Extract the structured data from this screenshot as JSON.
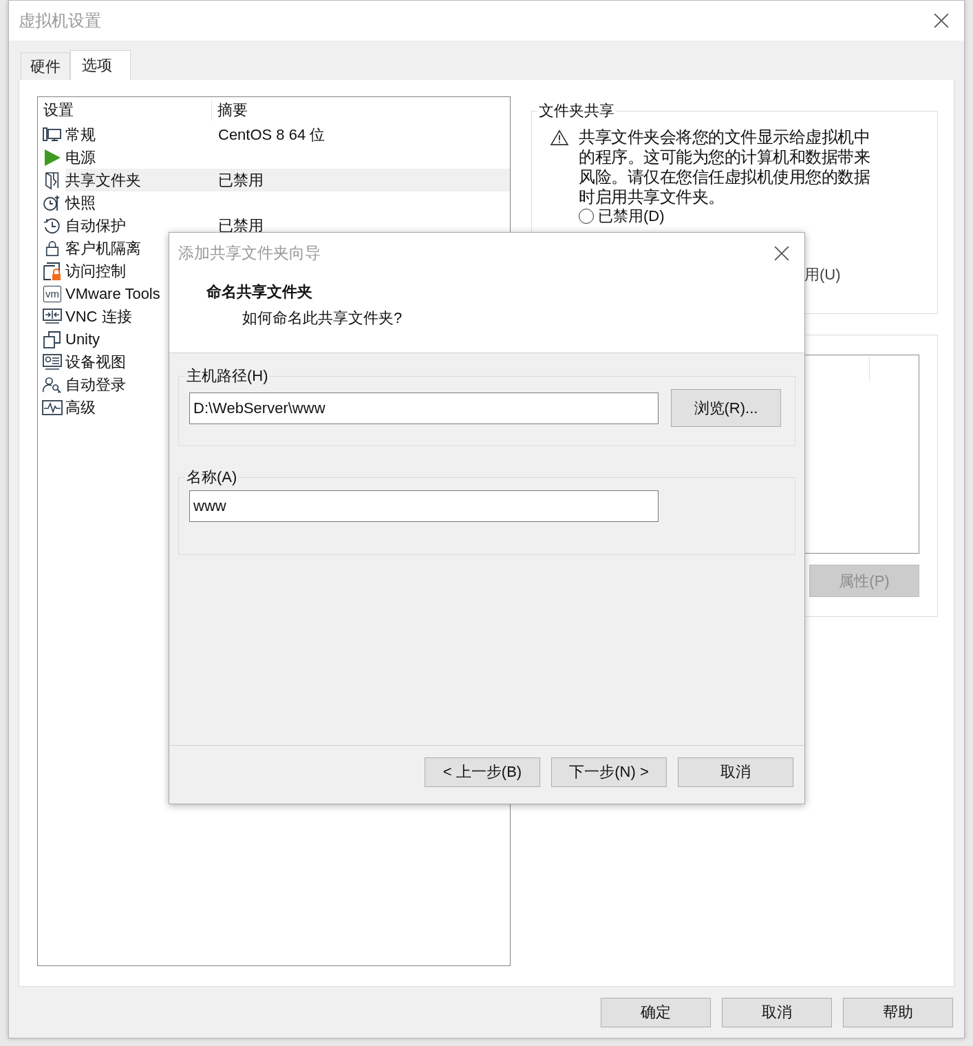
{
  "window": {
    "title": "虚拟机设置"
  },
  "tabs": [
    {
      "label": "硬件",
      "selected": false
    },
    {
      "label": "选项",
      "selected": true
    }
  ],
  "settings_list": {
    "columns": [
      "设置",
      "摘要"
    ],
    "rows": [
      {
        "name": "常规",
        "summary": "CentOS 8 64 位",
        "selected": false
      },
      {
        "name": "电源",
        "selected": false
      },
      {
        "name": "共享文件夹",
        "summary": "已禁用",
        "selected": true
      },
      {
        "name": "快照",
        "selected": false
      },
      {
        "name": "自动保护",
        "summary": "已禁用",
        "selected": false
      },
      {
        "name": "客户机隔离",
        "selected": false
      },
      {
        "name": "访问控制",
        "selected": false
      },
      {
        "name": "VMware Tools",
        "logo": "vm",
        "selected": false
      },
      {
        "name": "VNC 连接",
        "selected": false
      },
      {
        "name": "Unity",
        "selected": false
      },
      {
        "name": "设备视图",
        "selected": false
      },
      {
        "name": "自动登录",
        "selected": false
      },
      {
        "name": "高级",
        "selected": false
      }
    ]
  },
  "folder_sharing": {
    "title": "文件夹共享",
    "warning": "共享文件夹会将您的文件显示给虚拟机中的程序。这可能为您的计算机和数据带来风险。请仅在您信任虚拟机使用您的数据时启用共享文件夹。",
    "radio": {
      "label": "已禁用(D)",
      "selected": false
    },
    "partial_option": "用(U)"
  },
  "folders": {
    "properties_button": {
      "label": "属性(P)",
      "disabled": true
    }
  },
  "buttons": [
    "确定",
    "取消",
    "帮助"
  ],
  "wizard": {
    "title": "添加共享文件夹向导",
    "heading": "命名共享文件夹",
    "subheading": "如何命名此共享文件夹?",
    "host_path": {
      "label": "主机路径(H)",
      "value": "D:\\WebServer\\www",
      "browse": "浏览(R)..."
    },
    "name": {
      "label": "名称(A)",
      "value": "www"
    },
    "buttons": [
      "< 上一步(B)",
      "下一步(N) >",
      "取消"
    ]
  }
}
